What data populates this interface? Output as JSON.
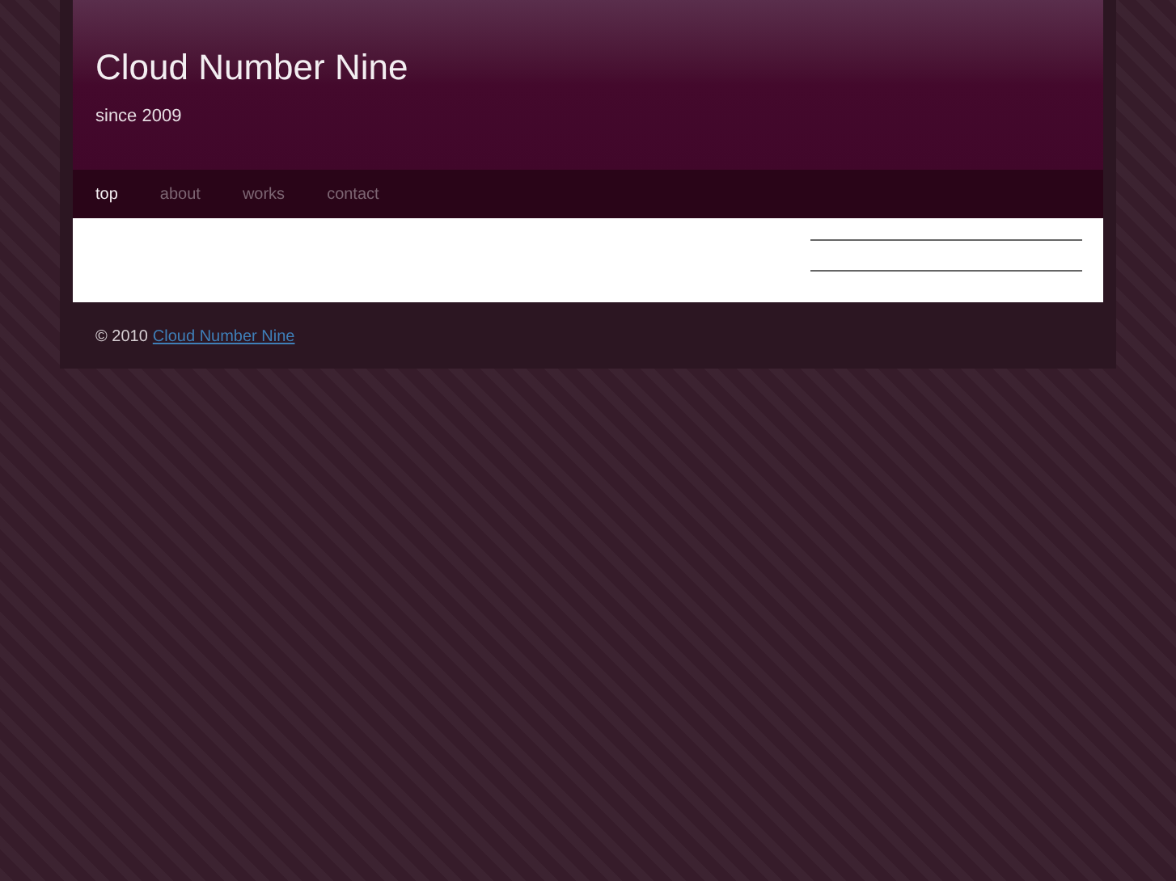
{
  "site": {
    "title": "Cloud Number Nine",
    "tagline": "since 2009"
  },
  "nav": [
    {
      "label": "top",
      "selected": true
    },
    {
      "label": "about",
      "selected": false
    },
    {
      "label": "works",
      "selected": false
    },
    {
      "label": "contact",
      "selected": false
    }
  ],
  "footer": {
    "copyright": "© 2010",
    "link": "Cloud Number Nine"
  }
}
